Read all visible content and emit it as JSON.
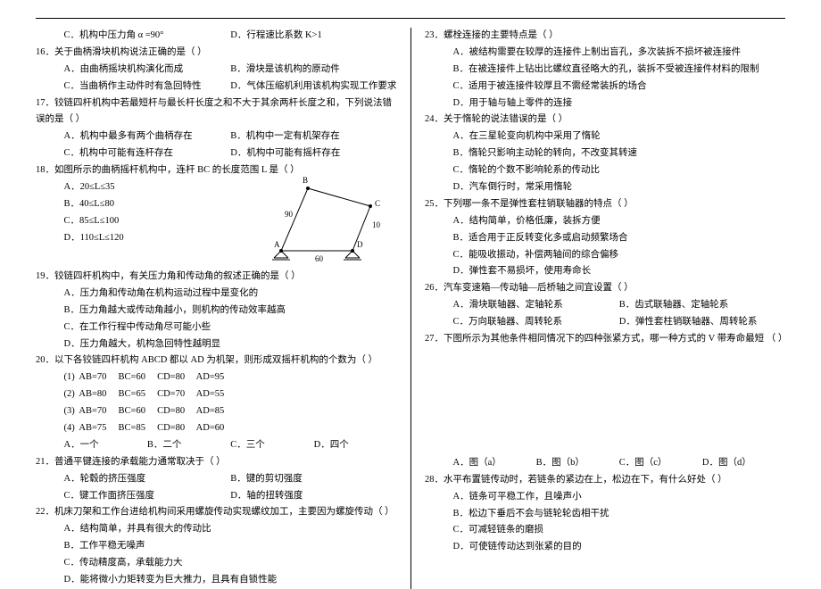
{
  "left": {
    "q15": {
      "optC": "C．机构中压力角 α =90°",
      "optD": "D．行程速比系数 K>1"
    },
    "q16": {
      "stem": "16．关于曲柄滑块机构说法正确的是（   ）",
      "optA": "A．由曲柄摇块机构演化而成",
      "optB": "B．滑块是该机构的原动件",
      "optC": "C．当曲柄作主动件时有急回特性",
      "optD": "D．气体压缩机利用该机构实现工作要求"
    },
    "q17": {
      "stem": "17．铰链四杆机构中若最短杆与最长杆长度之和不大于其余两杆长度之和，下列说法错误的是（   ）",
      "optA": "A．机构中最多有两个曲柄存在",
      "optB": "B．机构中一定有机架存在",
      "optC": "C．机构中可能有连杆存在",
      "optD": "D．机构中可能有摇杆存在"
    },
    "q18": {
      "stem": "18．如图所示的曲柄摇杆机构中，连杆 BC 的长度范围 L 是（   ）",
      "optA": "A．20≤L≤35",
      "optB": "B．40≤L≤80",
      "optC": "C．85≤L≤100",
      "optD": "D．110≤L≤120"
    },
    "q19": {
      "stem": "19．铰链四杆机构中，有关压力角和传动角的叙述正确的是（   ）",
      "optA": "A．压力角和传动角在机构运动过程中是变化的",
      "optB": "B．压力角越大或传动角越小，则机构的传动效率越高",
      "optC": "C．在工作行程中传动角尽可能小些",
      "optD": "D．压力角越大，机构急回特性越明显"
    },
    "q20": {
      "stem": "20．以下各铰链四杆机构 ABCD 都以 AD 为机架，则形成双摇杆机构的个数为（   ）",
      "row1": "(1)  AB=70     BC=60     CD=80     AD=95",
      "row2": "(2)  AB=80     BC=65     CD=70     AD=55",
      "row3": "(3)  AB=70     BC=60     CD=80     AD=85",
      "row4": "(4)  AB=75     BC=85     CD=80     AD=60",
      "optA": "A．一个",
      "optB": "B．二个",
      "optC": "C．三个",
      "optD": "D．四个"
    },
    "q21": {
      "stem": "21．普通平键连接的承载能力通常取决于（   ）",
      "optA": "A．轮毂的挤压强度",
      "optB": "B．键的剪切强度",
      "optC": "C．键工作面挤压强度",
      "optD": "D．轴的扭转强度"
    },
    "q22": {
      "stem": "22．机床刀架和工作台进给机构间采用螺旋传动实现螺纹加工，主要因为螺旋传动（   ）",
      "optA": "A．结构简单，并具有很大的传动比",
      "optB": "B．工作平稳无噪声",
      "optC": "C．传动精度高，承载能力大",
      "optD": "D．能将微小力矩转变为巨大推力，且具有自锁性能"
    }
  },
  "right": {
    "q23": {
      "stem": "23．螺栓连接的主要特点是（   ）",
      "optA": "A．被结构需要在较厚的连接件上制出盲孔，多次装拆不损坏被连接件",
      "optB": "B．在被连接件上钻出比螺纹直径略大的孔，装拆不受被连接件材料的限制",
      "optC": "C．适用于被连接件较厚且不需经常装拆的场合",
      "optD": "D．用于轴与轴上零件的连接"
    },
    "q24": {
      "stem": "24．关于惰轮的说法错误的是（   ）",
      "optA": "A．在三星轮变向机构中采用了惰轮",
      "optB": "B．惰轮只影响主动轮的转向，不改变其转速",
      "optC": "C．惰轮的个数不影响轮系的传动比",
      "optD": "D．汽车倒行时，常采用惰轮"
    },
    "q25": {
      "stem": "25．下列哪一条不是弹性套柱销联轴器的特点（   ）",
      "optA": "A．结构简单，价格低廉，装拆方便",
      "optB": "B．适合用于正反转变化多或启动频繁场合",
      "optC": "C．能吸收振动，补偿两轴间的综合偏移",
      "optD": "D．弹性套不易损坏，使用寿命长"
    },
    "q26": {
      "stem": "26．汽车变速箱—传动轴—后桥轴之间宜设置（   ）",
      "optA": "A．滑块联轴器、定轴轮系",
      "optB": "B．齿式联轴器、定轴轮系",
      "optC": "C．万向联轴器、周转轮系",
      "optD": "D．弹性套柱销联轴器、周转轮系"
    },
    "q27": {
      "stem": "27．下图所示为其他条件相同情况下的四种张紧方式，哪一种方式的 V 带寿命最短 （   ）",
      "optA": "A．图（a）",
      "optB": "B．图（b）",
      "optC": "C．图（c）",
      "optD": "D．图（d）"
    },
    "q28": {
      "stem": "28．水平布置链传动时，若链条的紧边在上，松边在下，有什么好处（   ）",
      "optA": "A．链条可平稳工作，且噪声小",
      "optB": "B．松边下垂后不会与链轮轮齿相干扰",
      "optC": "C．可减轻链条的磨损",
      "optD": "D．可使链传动达到张紧的目的"
    }
  },
  "diagram": {
    "B": "B",
    "C": "C",
    "A": "A",
    "D": "D",
    "l10": "10",
    "l90": "90",
    "l60": "60"
  }
}
